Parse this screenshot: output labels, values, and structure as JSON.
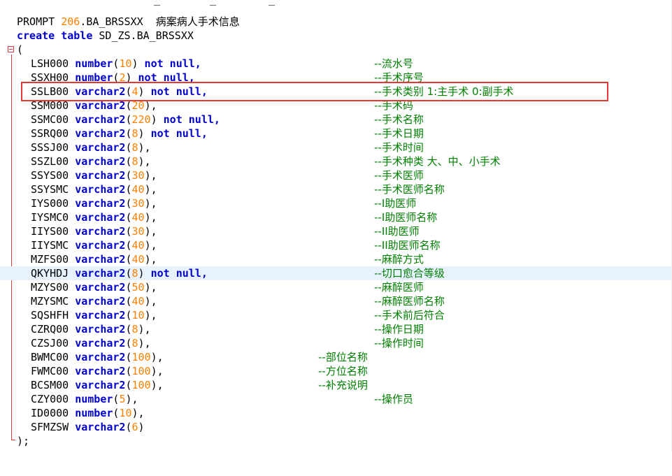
{
  "theme": {
    "keyword": "#0000cc",
    "number": "#ff8000",
    "comment": "#008000",
    "fold": "#e03c3c",
    "current_line": "#e8f2ff",
    "highlight_box": "#e53935"
  },
  "top_clip": [
    "_",
    "_",
    "_"
  ],
  "prompt_line": {
    "keyword": "PROMPT",
    "number": "206",
    "rest": ".BA_BRSSXX  ",
    "comment": "病案病人手术信息"
  },
  "create_line": {
    "kw1": "create",
    "kw2": "table",
    "rest": " SD_ZS.BA_BRSSXX"
  },
  "open_paren": "(",
  "columns": [
    {
      "name": "LSH000",
      "type": "number",
      "size": "10",
      "tail": " not null,",
      "comment": "--流水号",
      "col": "far"
    },
    {
      "name": "SSXH00",
      "type": "number",
      "size": "2",
      "tail": " not null,",
      "comment": "--手术序号",
      "col": "far"
    },
    {
      "name": "SSLB00",
      "type": "varchar2",
      "size": "4",
      "tail": " not null,",
      "comment": "--手术类别 1:主手术 0:副手术",
      "col": "far"
    },
    {
      "name": "SSM000",
      "type": "varchar2",
      "size": "20",
      "tail": ",",
      "comment": "--手术码",
      "col": "far"
    },
    {
      "name": "SSMC00",
      "type": "varchar2",
      "size": "220",
      "tail": " not null,",
      "comment": "--手术名称",
      "col": "far"
    },
    {
      "name": "SSRQ00",
      "type": "varchar2",
      "size": "8",
      "tail": " not null,",
      "comment": "--手术日期",
      "col": "far"
    },
    {
      "name": "SSSJ00",
      "type": "varchar2",
      "size": "8",
      "tail": ",",
      "comment": "--手术时间",
      "col": "far"
    },
    {
      "name": "SSZL00",
      "type": "varchar2",
      "size": "8",
      "tail": ",",
      "comment": "--手术种类 大、中、小手术",
      "col": "far"
    },
    {
      "name": "SSYS00",
      "type": "varchar2",
      "size": "30",
      "tail": ",",
      "comment": "--手术医师",
      "col": "far"
    },
    {
      "name": "SSYSMC",
      "type": "varchar2",
      "size": "40",
      "tail": ",",
      "comment": "--手术医师名称",
      "col": "far"
    },
    {
      "name": "IYS000",
      "type": "varchar2",
      "size": "30",
      "tail": ",",
      "comment": "--I助医师",
      "col": "far"
    },
    {
      "name": "IYSMC0",
      "type": "varchar2",
      "size": "40",
      "tail": ",",
      "comment": "--I助医师名称",
      "col": "far"
    },
    {
      "name": "IIYS00",
      "type": "varchar2",
      "size": "30",
      "tail": ",",
      "comment": "--II助医师",
      "col": "far"
    },
    {
      "name": "IIYSMC",
      "type": "varchar2",
      "size": "40",
      "tail": ",",
      "comment": "--II助医师名称",
      "col": "far"
    },
    {
      "name": "MZFS00",
      "type": "varchar2",
      "size": "40",
      "tail": ",",
      "comment": "--麻醉方式",
      "col": "far"
    },
    {
      "name": "QKYHDJ",
      "type": "varchar2",
      "size": "8",
      "tail": " not null,",
      "comment": "--切口愈合等级",
      "col": "far",
      "current": true
    },
    {
      "name": "MZYS00",
      "type": "varchar2",
      "size": "50",
      "tail": ",",
      "comment": "--麻醉医师",
      "col": "far"
    },
    {
      "name": "MZYSMC",
      "type": "varchar2",
      "size": "40",
      "tail": ",",
      "comment": "--麻醉医师名称",
      "col": "far"
    },
    {
      "name": "SQSHFH",
      "type": "varchar2",
      "size": "10",
      "tail": ",",
      "comment": "--手术前后符合",
      "col": "far"
    },
    {
      "name": "CZRQ00",
      "type": "varchar2",
      "size": "8",
      "tail": ",",
      "comment": "--操作日期",
      "col": "far"
    },
    {
      "name": "CZSJ00",
      "type": "varchar2",
      "size": "8",
      "tail": ",",
      "comment": "--操作时间",
      "col": "far"
    },
    {
      "name": "BWMC00",
      "type": "varchar2",
      "size": "100",
      "tail": ",",
      "comment": "--部位名称",
      "col": "near"
    },
    {
      "name": "FWMC00",
      "type": "varchar2",
      "size": "100",
      "tail": ",",
      "comment": "--方位名称",
      "col": "near"
    },
    {
      "name": "BCSM00",
      "type": "varchar2",
      "size": "100",
      "tail": ",",
      "comment": "--补充说明",
      "col": "near"
    },
    {
      "name": "CZY000",
      "type": "number",
      "size": "5",
      "tail": ",",
      "comment": "--操作员",
      "col": "far"
    },
    {
      "name": "ID0000",
      "type": "number",
      "size": "10",
      "tail": ",",
      "comment": "",
      "col": "far"
    },
    {
      "name": "SFMZSW",
      "type": "varchar2",
      "size": "6",
      "tail": "",
      "comment": "",
      "col": "far"
    }
  ],
  "close_paren": ");"
}
